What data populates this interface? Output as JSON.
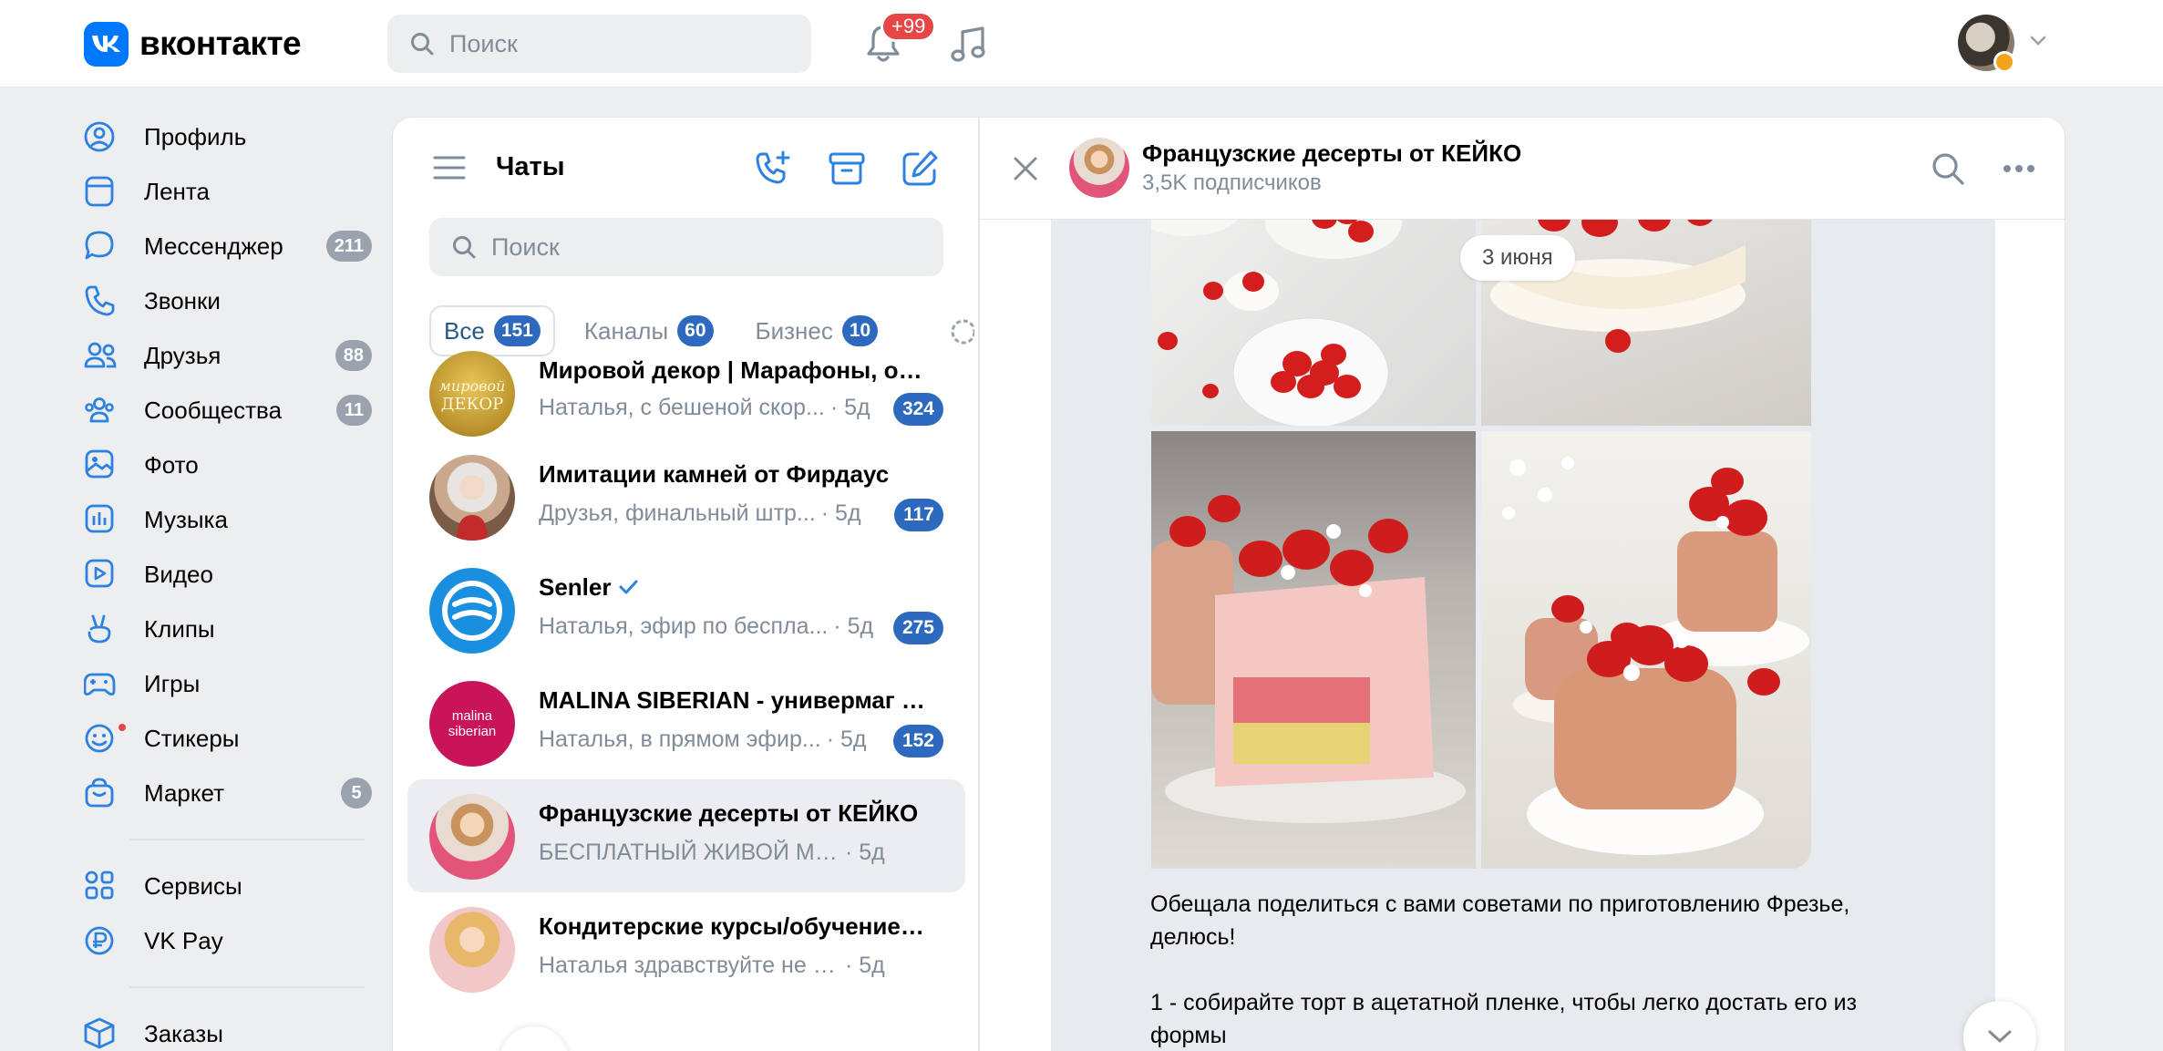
{
  "header": {
    "logo_text": "вконтакте",
    "search_placeholder": "Поиск",
    "notifications_badge": "+99"
  },
  "nav": {
    "items": [
      {
        "label": "Профиль",
        "icon": "profile-icon"
      },
      {
        "label": "Лента",
        "icon": "feed-icon"
      },
      {
        "label": "Мессенджер",
        "icon": "messenger-icon",
        "count": "211"
      },
      {
        "label": "Звонки",
        "icon": "phone-icon"
      },
      {
        "label": "Друзья",
        "icon": "friends-icon",
        "count": "88"
      },
      {
        "label": "Сообщества",
        "icon": "communities-icon",
        "count": "11"
      },
      {
        "label": "Фото",
        "icon": "photo-icon"
      },
      {
        "label": "Музыка",
        "icon": "music-icon"
      },
      {
        "label": "Видео",
        "icon": "video-icon"
      },
      {
        "label": "Клипы",
        "icon": "clips-icon"
      },
      {
        "label": "Игры",
        "icon": "games-icon"
      },
      {
        "label": "Стикеры",
        "icon": "stickers-icon"
      },
      {
        "label": "Маркет",
        "icon": "market-icon",
        "count": "5"
      }
    ],
    "secondary": [
      {
        "label": "Сервисы",
        "icon": "services-icon"
      },
      {
        "label": "VK Pay",
        "icon": "vkpay-icon"
      }
    ],
    "tertiary": [
      {
        "label": "Заказы",
        "icon": "orders-icon"
      }
    ]
  },
  "chats": {
    "title": "Чаты",
    "search_placeholder": "Поиск",
    "tabs": [
      {
        "label": "Все",
        "count": "151",
        "active": true
      },
      {
        "label": "Каналы",
        "count": "60"
      },
      {
        "label": "Бизнес",
        "count": "10"
      }
    ],
    "list": [
      {
        "name": "Мировой декор | Марафоны, обу...",
        "preview": "Наталья, с бешеной скор...",
        "time": "· 5д",
        "unread": "324"
      },
      {
        "name": "Имитации камней от Фирдаус",
        "preview": "Друзья, финальный штр...",
        "time": "· 5д",
        "unread": "117"
      },
      {
        "name": "Senler",
        "preview": "Наталья, эфир по бесплa...",
        "time": "· 5д",
        "unread": "275",
        "verified": true
      },
      {
        "name": "MALINA SIBERIAN - универмаг ве...",
        "preview": "Наталья, в прямом эфир...",
        "time": "· 5д",
        "unread": "152",
        "avatar_text": "malina siberian"
      },
      {
        "name": "Французские десерты от КЕЙКО",
        "preview": "БЕСПЛАТНЫЙ ЖИВОЙ МАСТЕ...",
        "time": "· 5д",
        "selected": true
      },
      {
        "name": "Кондитерские курсы/обучение ш...",
        "preview": "Наталья здравствуйте не поня...",
        "time": "· 5д"
      }
    ]
  },
  "conversation": {
    "title": "Французские десерты от КЕЙКО",
    "subtitle": "3,5K подписчиков",
    "date_label": "3 июня",
    "message_line1": "Обещала поделиться с вами советами по приготовлению Фрезье, делюсь!",
    "message_line2": "1 - собирайте торт в ацетатной пленке, чтобы легко достать его из формы"
  },
  "colors": {
    "accent": "#0077ff",
    "badge_blue": "#2d6abf",
    "badge_gray": "#99a2ad",
    "notif_red": "#e64646",
    "background": "#edeef0"
  }
}
